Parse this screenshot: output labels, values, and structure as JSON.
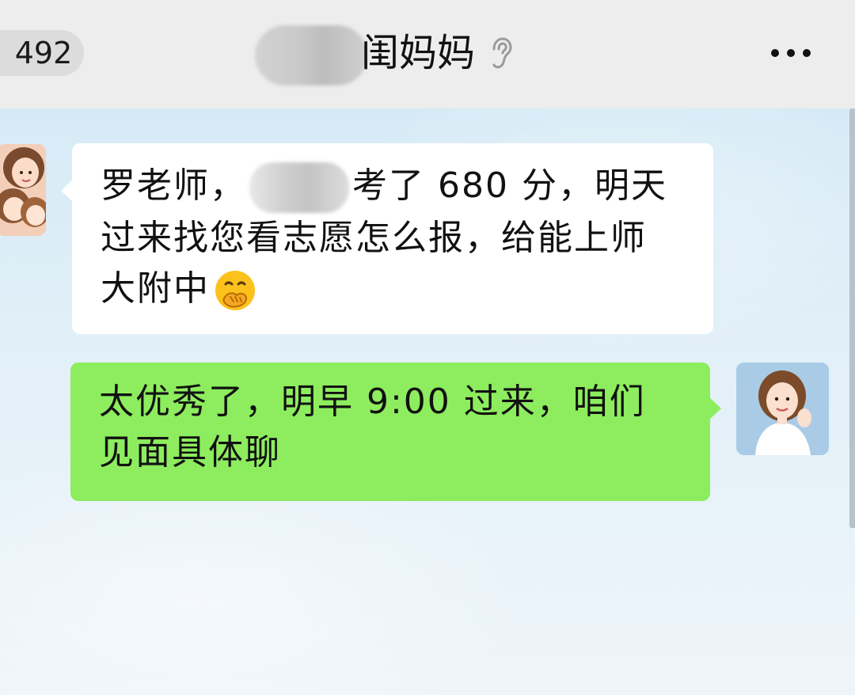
{
  "header": {
    "unread_count": "492",
    "title_visible": "闺妈妈",
    "more_label": "···"
  },
  "messages": [
    {
      "side": "left",
      "lines": [
        "罗老师，",
        "考了 680 分，明天",
        "过来找您看志愿怎么报，给能上师",
        "大附中"
      ],
      "emoji": "hand-over-mouth-emoji"
    },
    {
      "side": "right",
      "lines": [
        "太优秀了，明早 9:00 过来，咱们",
        "见面具体聊"
      ]
    }
  ],
  "colors": {
    "header_bg": "#ededed",
    "incoming_bubble": "#ffffff",
    "outgoing_bubble": "#8ded5e",
    "chat_bg": "#d9ecf7"
  }
}
